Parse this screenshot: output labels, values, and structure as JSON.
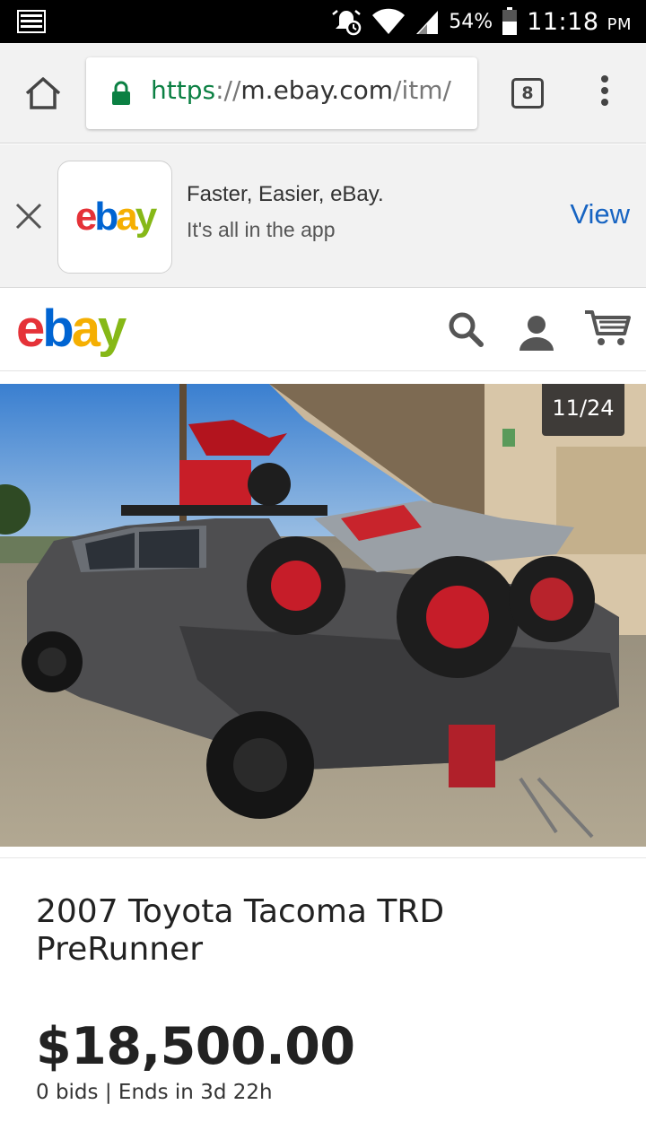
{
  "status_bar": {
    "battery_pct": "54%",
    "time": "11:18",
    "ampm": "PM",
    "icons": [
      "notification-icon",
      "alarm-icon",
      "wifi-icon",
      "signal-icon",
      "battery-icon"
    ]
  },
  "browser": {
    "url_scheme": "https",
    "url_sep": "://",
    "url_host": "m.ebay.com",
    "url_path": "/itm/",
    "tab_count": "8"
  },
  "app_banner": {
    "title": "Faster, Easier, eBay.",
    "subtitle": "It's all in the app",
    "cta": "View"
  },
  "logo": {
    "e": "e",
    "b": "b",
    "a": "a",
    "y": "y"
  },
  "gallery": {
    "counter": "11/24"
  },
  "listing": {
    "title": "2007 Toyota Tacoma TRD PreRunner",
    "price": "$18,500.00",
    "bids": "0 bids",
    "separator": " | ",
    "ends": "Ends in 3d 22h"
  },
  "colors": {
    "ebay_red": "#e53238",
    "ebay_blue": "#0064d2",
    "ebay_yellow": "#f5af02",
    "ebay_green": "#86b817",
    "secure_green": "#0b8043",
    "link_blue": "#1764c2"
  }
}
